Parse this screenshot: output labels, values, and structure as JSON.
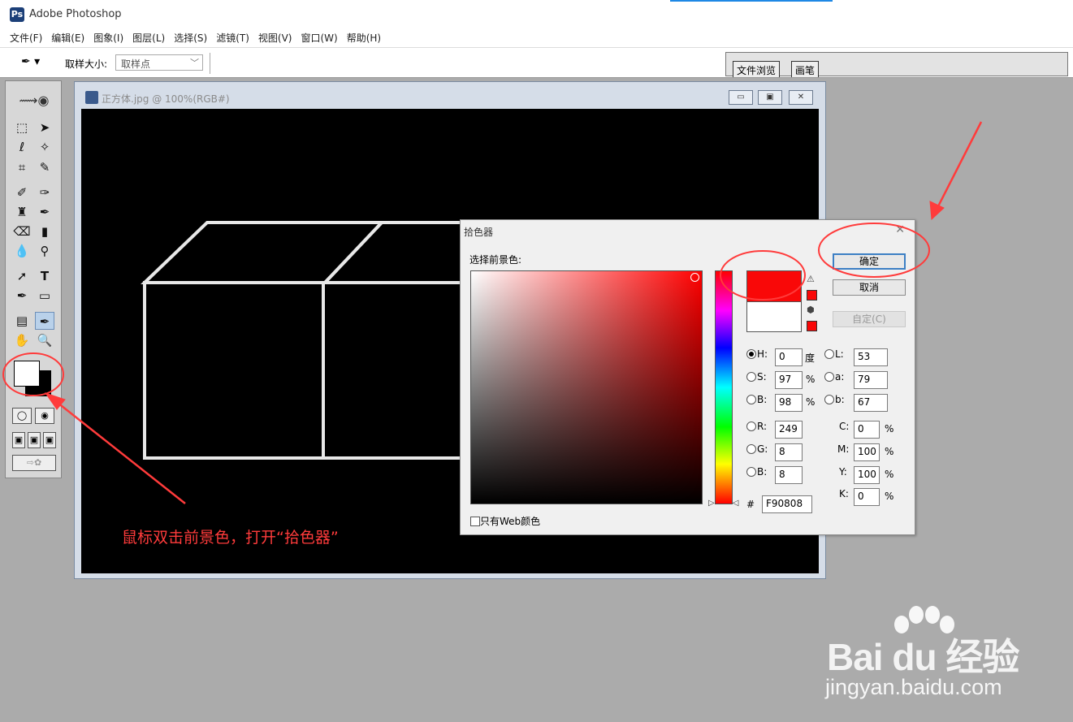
{
  "app": {
    "title": "Adobe Photoshop",
    "icon": "photoshop-logo-icon"
  },
  "menu": [
    "文件(F)",
    "编辑(E)",
    "图象(I)",
    "图层(L)",
    "选择(S)",
    "滤镜(T)",
    "视图(V)",
    "窗口(W)",
    "帮助(H)"
  ],
  "options": {
    "tool_icon": "eyedropper-icon",
    "sample_label": "取样大小:",
    "sample_value": "取样点",
    "tabs": [
      "文件浏览",
      "画笔"
    ]
  },
  "document": {
    "title": "正方体.jpg @ 100%(RGB#)"
  },
  "picker": {
    "title": "拾色器",
    "prompt": "选择前景色:",
    "ok": "确定",
    "cancel": "取消",
    "custom": "自定(C)",
    "hsb": {
      "H": "0",
      "S": "97",
      "B": "98",
      "H_unit": "度",
      "S_unit": "%",
      "B_unit": "%"
    },
    "lab": {
      "L": "53",
      "a": "79",
      "b": "67"
    },
    "rgb": {
      "R": "249",
      "G": "8",
      "B": "8"
    },
    "cmyk": {
      "C": "0",
      "M": "100",
      "Y": "100",
      "K": "0",
      "unit": "%"
    },
    "hex_label": "#",
    "hex": "F90808",
    "web_only": "只有Web颜色",
    "new_color": "#f90808",
    "old_color": "#ffffff"
  },
  "annotation": {
    "text": "鼠标双击前景色，打开“拾色器”",
    "color": "#ff3b3b"
  },
  "watermark": {
    "brand": "Bai du 经验",
    "url": "jingyan.baidu.com"
  }
}
